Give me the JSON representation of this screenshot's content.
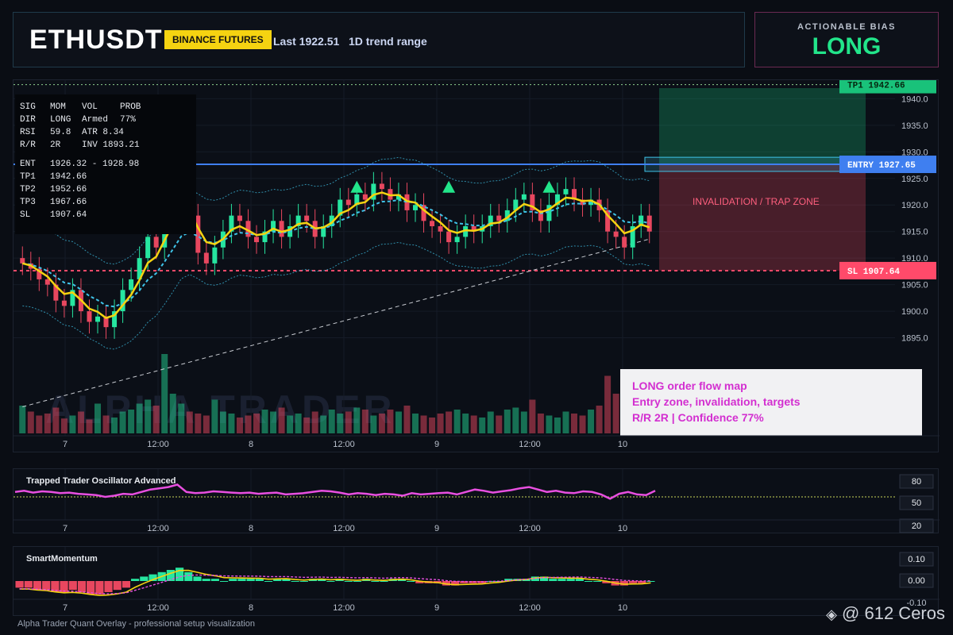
{
  "header": {
    "symbol": "ETHUSDT",
    "exchange_badge": "BINANCE FUTURES",
    "last_label": "Last 1922.51   1D trend range"
  },
  "bias": {
    "label": "ACTIONABLE BIAS",
    "value": "LONG"
  },
  "info_table": {
    "rows": [
      [
        "SIG",
        "MOM",
        "VOL",
        "PROB"
      ],
      [
        "DIR",
        "LONG",
        "Armed",
        "77%"
      ],
      [
        "RSI",
        "59.8",
        "ATR 8.34",
        ""
      ],
      [
        "R/R",
        "2R",
        "INV 1893.21",
        ""
      ]
    ],
    "levels": [
      [
        "ENT",
        "1926.32 - 1928.98"
      ],
      [
        "TP1",
        "1942.66"
      ],
      [
        "TP2",
        "1952.66"
      ],
      [
        "TP3",
        "1967.66"
      ],
      [
        "SL",
        "1907.64"
      ]
    ]
  },
  "price_tags": {
    "tp1": "TP1 1942.66",
    "entry": "ENTRY 1927.65",
    "sl": "SL 1907.64"
  },
  "zone_label": "INVALIDATION / TRAP ZONE",
  "watermark_chart": "ALPHA TRADER",
  "overlay_box": {
    "line1": "LONG order flow map",
    "line2": "Entry zone, invalidation, targets",
    "line3": "R/R 2R | Confidence 77%"
  },
  "colors": {
    "bull": "#26e6a0",
    "bear": "#e8475f",
    "ema_fast": "#f5d311",
    "ema_mid": "#3fc3e8",
    "tp": "#19c27a",
    "entry": "#3f7ff0",
    "sl": "#ff4a6a",
    "oscillator": "#e84fe0"
  },
  "chart_data": [
    {
      "type": "line",
      "title": "",
      "y_ticks": [
        1895,
        1900,
        1905,
        1910,
        1915,
        1920,
        1925,
        1930,
        1935,
        1940
      ],
      "ylim": [
        1877,
        1942
      ],
      "x_ticks": [
        "7",
        "12:00",
        "8",
        "12:00",
        "9",
        "12:00",
        "10"
      ],
      "levels": {
        "tp1": 1942.66,
        "entry": 1927.65,
        "sl": 1907.64
      },
      "close_series": [
        1909,
        1908,
        1906,
        1905,
        1902,
        1901,
        1904,
        1900,
        1898,
        1899,
        1897,
        1900,
        1904,
        1906,
        1910,
        1914,
        1912,
        1918,
        1921,
        1924,
        1918,
        1911,
        1909,
        1912,
        1915,
        1918,
        1917,
        1914,
        1913,
        1915,
        1917,
        1914,
        1916,
        1918,
        1917,
        1914,
        1916,
        1918,
        1921,
        1920,
        1922,
        1921,
        1924,
        1923,
        1921,
        1922,
        1919,
        1920,
        1917,
        1916,
        1915,
        1913,
        1914,
        1916,
        1915,
        1916,
        1918,
        1917,
        1919,
        1921,
        1922,
        1919,
        1917,
        1920,
        1922,
        1923,
        1921,
        1920,
        1921,
        1919,
        1915,
        1914,
        1912,
        1916,
        1918,
        1915
      ],
      "volume": [
        28,
        22,
        18,
        20,
        26,
        15,
        18,
        22,
        14,
        30,
        18,
        16,
        22,
        24,
        30,
        34,
        28,
        80,
        40,
        30,
        22,
        20,
        18,
        34,
        22,
        20,
        16,
        18,
        20,
        24,
        22,
        26,
        18,
        20,
        16,
        22,
        18,
        24,
        20,
        22,
        26,
        24,
        18,
        20,
        24,
        22,
        28,
        20,
        18,
        16,
        20,
        22,
        24,
        20,
        18,
        16,
        22,
        18,
        24,
        26,
        22,
        34,
        20,
        18,
        16,
        22,
        20,
        18,
        24,
        28,
        58,
        40,
        26,
        30,
        24,
        20
      ]
    },
    {
      "type": "line",
      "title": "Trapped Trader Oscillator Advanced",
      "y_ticks": [
        80,
        50,
        20
      ],
      "x_ticks": [
        "7",
        "12:00",
        "8",
        "12:00",
        "9",
        "12:00",
        "10"
      ],
      "values": [
        58,
        60,
        57,
        59,
        58,
        56,
        57,
        55,
        54,
        53,
        50,
        52,
        55,
        54,
        58,
        62,
        64,
        66,
        70,
        58,
        56,
        57,
        59,
        58,
        57,
        56,
        57,
        55,
        56,
        57,
        54,
        55,
        56,
        58,
        60,
        59,
        57,
        54,
        56,
        55,
        53,
        55,
        54,
        52,
        56,
        54,
        55,
        56,
        57,
        54,
        58,
        62,
        60,
        57,
        59,
        61,
        64,
        66,
        62,
        58,
        60,
        57,
        56,
        59,
        58,
        54,
        47,
        55,
        58,
        54,
        53,
        60
      ]
    },
    {
      "type": "bar",
      "title": "SmartMomentum",
      "y_ticks": [
        0.1,
        0.0,
        -0.1
      ],
      "x_ticks": [
        "7",
        "12:00",
        "8",
        "12:00",
        "9",
        "12:00",
        "10"
      ],
      "values": [
        -0.03,
        -0.03,
        -0.04,
        -0.04,
        -0.05,
        -0.05,
        -0.04,
        -0.05,
        -0.06,
        -0.06,
        -0.05,
        -0.04,
        -0.03,
        0.01,
        0.02,
        0.03,
        0.04,
        0.05,
        0.06,
        0.04,
        0.02,
        0.01,
        0.01,
        0.0,
        0.01,
        0.01,
        0.01,
        0.01,
        0.0,
        0.01,
        0.01,
        0.0,
        0.0,
        0.01,
        0.01,
        0.0,
        0.01,
        0.0,
        0.0,
        0.01,
        0.0,
        0.0,
        0.01,
        0.01,
        0.0,
        -0.01,
        -0.01,
        -0.01,
        -0.02,
        -0.02,
        -0.01,
        -0.01,
        -0.01,
        0.0,
        0.0,
        0.01,
        0.01,
        0.01,
        0.02,
        0.02,
        0.01,
        0.01,
        0.01,
        0.01,
        0.0,
        0.0,
        -0.01,
        -0.02,
        -0.02,
        -0.01,
        -0.01,
        0.0
      ]
    }
  ],
  "footer": "Alpha Trader Quant Overlay - professional setup visualization",
  "attribution": "@ 612 Ceros"
}
